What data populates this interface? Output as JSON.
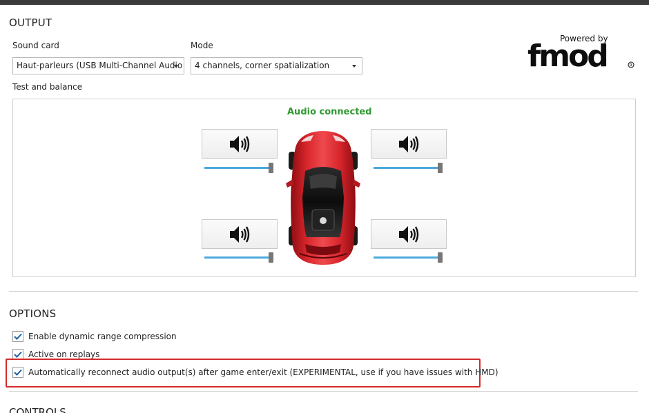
{
  "output": {
    "title": "OUTPUT",
    "sound_card_label": "Sound card",
    "sound_card_value": "Haut-parleurs (USB Multi-Channel Audio",
    "mode_label": "Mode",
    "mode_value": "4 channels, corner spatialization",
    "test_balance_label": "Test and balance",
    "status": "Audio connected",
    "speakers": [
      {
        "id": "front-left",
        "icon": "speaker-icon",
        "volume": 1.0
      },
      {
        "id": "front-right",
        "icon": "speaker-icon",
        "volume": 1.0
      },
      {
        "id": "rear-left",
        "icon": "speaker-icon",
        "volume": 1.0
      },
      {
        "id": "rear-right",
        "icon": "speaker-icon",
        "volume": 1.0
      }
    ]
  },
  "logo": {
    "powered_by": "Powered by",
    "brand": "fmod"
  },
  "options": {
    "title": "OPTIONS",
    "items": [
      {
        "label": "Enable dynamic range compression",
        "checked": true
      },
      {
        "label": "Active on replays",
        "checked": true
      },
      {
        "label": "Automatically reconnect audio output(s) after game enter/exit (EXPERIMENTAL, use if you have issues with HMD)",
        "checked": true
      }
    ]
  },
  "controls": {
    "title": "CONTROLS"
  },
  "colors": {
    "status_green": "#2e9a2e",
    "slider_blue": "#4aa8dd",
    "highlight_red": "#d42a2a",
    "check_blue": "#1a5fa8"
  }
}
